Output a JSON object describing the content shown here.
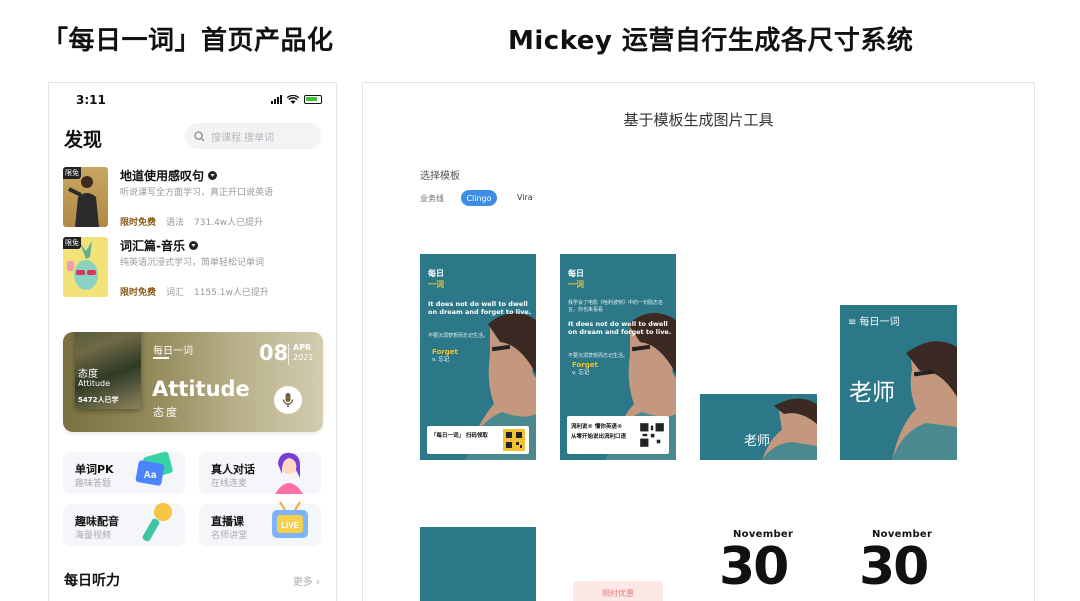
{
  "headers": {
    "left": "「每日一词」首页产品化",
    "right": "Mickey 运营自行生成各尺寸系统"
  },
  "phone": {
    "status": {
      "time": "3:11"
    },
    "title": "发现",
    "search_placeholder": "搜课程 搜单词",
    "courses": [
      {
        "tag": "限免",
        "title": "地道使用感叹句",
        "desc": "听说课写全方面学习，真正开口说英语",
        "free": "限时免费",
        "category": "语法",
        "learners": "731.4w人已提升"
      },
      {
        "tag": "限免",
        "title": "词汇篇-音乐",
        "desc": "纯英语沉浸式学习，简单轻松记单词",
        "free": "限时免费",
        "category": "词汇",
        "learners": "1155.1w人已提升"
      }
    ],
    "word_card": {
      "image_cn": "态度",
      "image_en": "Attitude",
      "image_count": "5472人已学",
      "label": "每日一词",
      "word": "Attitude",
      "word_cn": "态度",
      "day": "08",
      "month": "APR",
      "year": "2021"
    },
    "features": [
      {
        "title": "单词PK",
        "subtitle": "趣味答题"
      },
      {
        "title": "真人对话",
        "subtitle": "在线连麦"
      },
      {
        "title": "趣味配音",
        "subtitle": "海量视频"
      },
      {
        "title": "直播课",
        "subtitle": "名师讲堂"
      }
    ],
    "feature_badges": {
      "pk_icon": "Aa",
      "live_icon": "LIVE"
    },
    "section_title": "每日听力",
    "more": "更多 ›"
  },
  "tool": {
    "title": "基于模板生成图片工具",
    "template_label": "选择模板",
    "biz_label": "业务线",
    "options": [
      "Clingo",
      "Vira"
    ],
    "selected": "Clingo",
    "posters": {
      "p1": {
        "logo_a": "每日",
        "logo_b": "一词",
        "en": "It does not do well to dwell on dream and forget to live.",
        "sub": "不要沉溺梦想而忘记生活。",
        "word": "Forget",
        "word_cn": "v. 忘记",
        "qr_text": "「每日一词」 扫码领取"
      },
      "p2": {
        "logo_a": "每日",
        "logo_b": "一词",
        "pre": "我学会了电影《哈利波特》中的一句励志名言，你也来看看",
        "en": "It does not do well to dwell on dream and forget to live.",
        "sub": "不要沉溺梦想而忘记生活。",
        "word": "Forget",
        "word_cn": "v. 忘记",
        "qr_line1": "流利说® 懂你英语®",
        "qr_line2": "从零开始说出流利口语"
      },
      "p3": {
        "word": "老师"
      },
      "p4": {
        "label": "≡ 每日一词",
        "word": "老师"
      },
      "nov1": {
        "month": "November",
        "day": "30"
      },
      "nov2": {
        "month": "November",
        "day": "30"
      },
      "promo": "限时优惠"
    }
  },
  "colors": {
    "accent": "#3d8de6",
    "poster_bg": "#2d7888",
    "gold": "#f2c230",
    "free_text": "#8a5a1c"
  }
}
